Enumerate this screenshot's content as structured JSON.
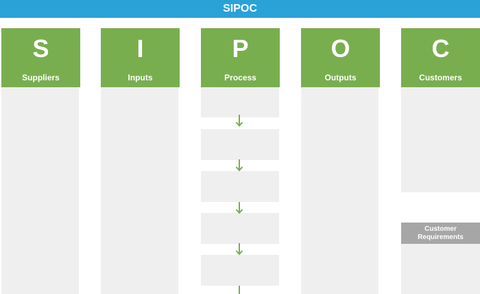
{
  "title": "SIPOC",
  "colors": {
    "title_bg": "#2aa2d8",
    "header_bg": "#79ae4f",
    "body_bg": "#efefef",
    "arrow": "#79ae4f",
    "requirements_bg": "#a6a6a6"
  },
  "columns": [
    {
      "letter": "S",
      "name": "Suppliers"
    },
    {
      "letter": "I",
      "name": "Inputs"
    },
    {
      "letter": "P",
      "name": "Process"
    },
    {
      "letter": "O",
      "name": "Outputs"
    },
    {
      "letter": "C",
      "name": "Customers"
    }
  ],
  "process_step_count": 5,
  "requirements": {
    "line1": "Customer",
    "line2": "Requirements"
  }
}
